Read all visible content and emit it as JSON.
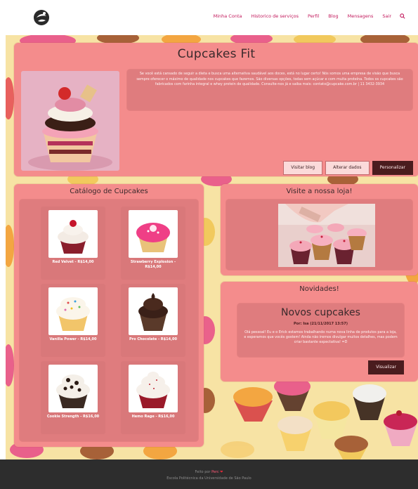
{
  "nav": {
    "items": [
      "Minha Conta",
      "Historico de serviços",
      "Perfil",
      "Blog",
      "Mensagens",
      "Sair"
    ]
  },
  "hero": {
    "title": "Cupcakes Fit",
    "description": "Se você está cansado de seguir a dieta e busca uma alternativa saudável aos doces, está no lugar certo! Nós somos uma empresa de visão que busca sempre oferecer o máximo de qualidade nos cupcakes que fazemos. São diversas opções, todas sem açúcar e com muita proteína. Todos os cupcakes são fabricados com farinha integral e whey protein de qualidade. Consulte-nos já e saiba mais: contato@cupcake.com.br | 11 3432-3934",
    "buttons": {
      "blog": "Visitar blog",
      "edit": "Alterar dados",
      "customize": "Personalizar"
    }
  },
  "catalog": {
    "title": "Catálogo de Cupcakes",
    "products": [
      {
        "label": "Red Velvet - R$14,00"
      },
      {
        "label": "Strawberry Explosion - R$14,00"
      },
      {
        "label": "Vanilla Power - R$14,00"
      },
      {
        "label": "Pro Chocolate - R$14,00"
      },
      {
        "label": "Cookie Strength - R$16,00"
      },
      {
        "label": "Hemo Rage - R$16,00"
      }
    ]
  },
  "store": {
    "title": "Visite a nossa loja!"
  },
  "news": {
    "title": "Novidades!",
    "post_title": "Novos cupcakes",
    "meta": "Por: Isa (21/11/2017 13:57)",
    "body": "Olá pessoal! Eu e o Erick estamos trabalhando numa nova linha de produtos para a loja, e esperamos que vocês gostem! Ainda não iremos divulgar muitos detalhes, mas podem criar bastante expectativa! =D",
    "button": "Visualizar"
  },
  "footer": {
    "made_by": "Feito por",
    "author": "Perc",
    "institution": "Escola Politécnica da Universidade de São Paulo"
  },
  "colors": {
    "panel": "#f48c8c",
    "inner": "#df7c7e",
    "accent_dark": "#4a1c1e",
    "nav_link": "#c2185b",
    "background": "#f7e3a4",
    "footer": "#2d2d2d"
  }
}
